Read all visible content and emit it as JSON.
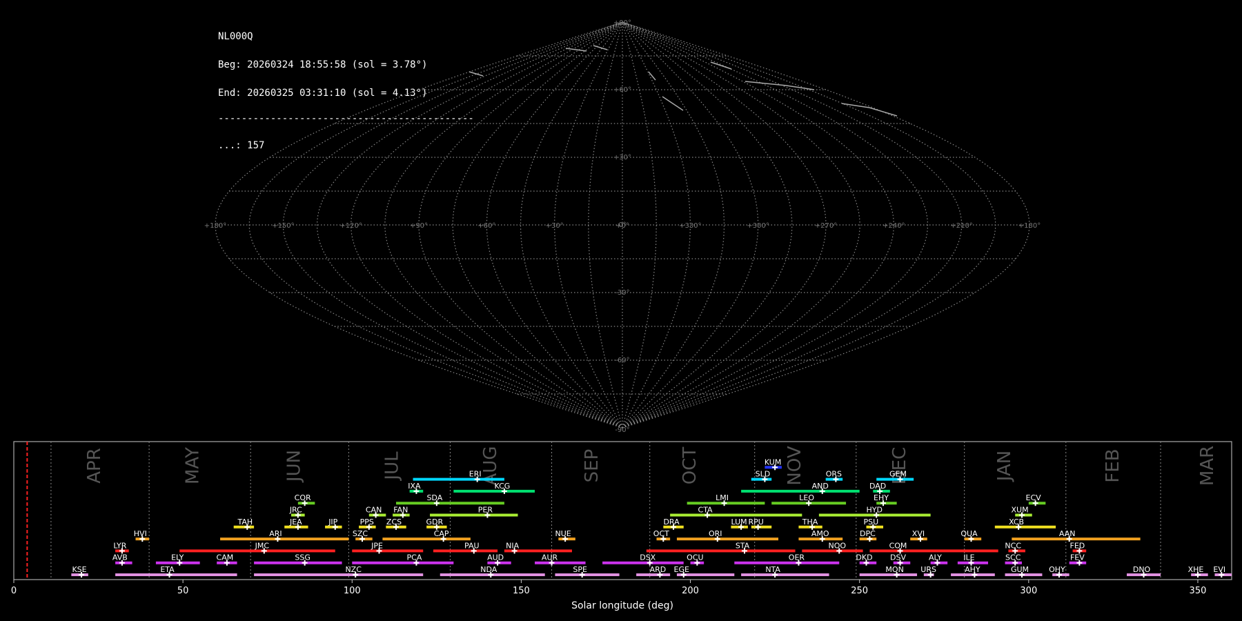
{
  "info": {
    "station": "NL000Q",
    "begin": "Beg: 20260324 18:55:58 (sol = 3.78°)",
    "end": "End: 20260325 03:31:10 (sol = 4.13°)",
    "separator": "--------------------------------------------",
    "count": "...: 157"
  },
  "sky": {
    "lat_labels": [
      "+90°",
      "+60°",
      "+30°",
      "0°",
      "-30°",
      "-60°",
      "-90°"
    ],
    "lon_labels": [
      "+180°",
      "+150°",
      "+120°",
      "+90°",
      "+60°",
      "+30°",
      "+0°",
      "+330°",
      "+300°",
      "+270°",
      "+240°",
      "+210°",
      "+180°"
    ]
  },
  "timeline": {
    "xlabel": "Solar longitude (deg)",
    "xticks": [
      "0",
      "50",
      "100",
      "150",
      "200",
      "250",
      "300",
      "350"
    ],
    "current_sol": 3.95,
    "months": [
      {
        "name": "APR",
        "x": 24
      },
      {
        "name": "MAY",
        "x": 53
      },
      {
        "name": "JUN",
        "x": 83
      },
      {
        "name": "JUL",
        "x": 112
      },
      {
        "name": "AUG",
        "x": 141
      },
      {
        "name": "SEP",
        "x": 171
      },
      {
        "name": "OCT",
        "x": 200
      },
      {
        "name": "NOV",
        "x": 231
      },
      {
        "name": "DEC",
        "x": 262
      },
      {
        "name": "JAN",
        "x": 293
      },
      {
        "name": "FEB",
        "x": 325
      },
      {
        "name": "MAR",
        "x": 353
      }
    ],
    "month_boundaries": [
      11,
      40,
      70,
      99,
      129,
      159,
      188,
      219,
      249,
      281,
      311,
      339
    ],
    "colors": {
      "white": "#ffffff",
      "blue": "#2233ff",
      "cyan": "#00d8ff",
      "green": "#00e070",
      "lime": "#66cc22",
      "yellowgreen": "#aaee33",
      "yellow": "#f0e020",
      "orange": "#f0a020",
      "red": "#ff2020",
      "magenta": "#cc33ee",
      "pink": "#e090e0"
    },
    "showers": [
      {
        "code": "KUM",
        "start": 222,
        "end": 227,
        "peak": 225,
        "row": 10,
        "color": "blue"
      },
      {
        "code": "ERI",
        "start": 118,
        "end": 145,
        "peak": 137,
        "row": 9,
        "color": "cyan"
      },
      {
        "code": "SLD",
        "start": 218,
        "end": 224,
        "peak": 222,
        "row": 9,
        "color": "cyan"
      },
      {
        "code": "ORS",
        "start": 240,
        "end": 245,
        "peak": 243,
        "row": 9,
        "color": "cyan"
      },
      {
        "code": "GEM",
        "start": 255,
        "end": 266,
        "peak": 262,
        "row": 9,
        "color": "cyan"
      },
      {
        "code": "IXA",
        "start": 117,
        "end": 121,
        "peak": 119,
        "row": 8,
        "color": "green"
      },
      {
        "code": "KCG",
        "start": 130,
        "end": 154,
        "peak": 145,
        "row": 8,
        "color": "green"
      },
      {
        "code": "AND",
        "start": 215,
        "end": 250,
        "peak": 239,
        "row": 8,
        "color": "green"
      },
      {
        "code": "DAD",
        "start": 254,
        "end": 259,
        "peak": 256,
        "row": 8,
        "color": "green"
      },
      {
        "code": "COR",
        "start": 84,
        "end": 89,
        "peak": 86,
        "row": 7,
        "color": "lime"
      },
      {
        "code": "SDA",
        "start": 113,
        "end": 145,
        "peak": 125,
        "row": 7,
        "color": "lime"
      },
      {
        "code": "LMI",
        "start": 199,
        "end": 222,
        "peak": 210,
        "row": 7,
        "color": "lime"
      },
      {
        "code": "LEO",
        "start": 224,
        "end": 246,
        "peak": 235,
        "row": 7,
        "color": "lime"
      },
      {
        "code": "EHY",
        "start": 255,
        "end": 261,
        "peak": 257,
        "row": 7,
        "color": "lime"
      },
      {
        "code": "ECV",
        "start": 300,
        "end": 305,
        "peak": 302,
        "row": 7,
        "color": "lime"
      },
      {
        "code": "JRC",
        "start": 82,
        "end": 86,
        "peak": 84,
        "row": 6,
        "color": "yellowgreen"
      },
      {
        "code": "CAN",
        "start": 105,
        "end": 110,
        "peak": 107,
        "row": 6,
        "color": "yellowgreen"
      },
      {
        "code": "FAN",
        "start": 112,
        "end": 117,
        "peak": 115,
        "row": 6,
        "color": "yellowgreen"
      },
      {
        "code": "PER",
        "start": 123,
        "end": 149,
        "peak": 140,
        "row": 6,
        "color": "yellowgreen"
      },
      {
        "code": "CTA",
        "start": 194,
        "end": 233,
        "peak": 205,
        "row": 6,
        "color": "yellowgreen"
      },
      {
        "code": "HYD",
        "start": 238,
        "end": 271,
        "peak": 255,
        "row": 6,
        "color": "yellowgreen"
      },
      {
        "code": "XUM",
        "start": 296,
        "end": 301,
        "peak": 298,
        "row": 6,
        "color": "yellowgreen"
      },
      {
        "code": "TAH",
        "start": 65,
        "end": 71,
        "peak": 69,
        "row": 5,
        "color": "yellow"
      },
      {
        "code": "JEA",
        "start": 80,
        "end": 87,
        "peak": 84,
        "row": 5,
        "color": "yellow"
      },
      {
        "code": "JIP",
        "start": 92,
        "end": 97,
        "peak": 95,
        "row": 5,
        "color": "yellow"
      },
      {
        "code": "PPS",
        "start": 102,
        "end": 107,
        "peak": 105,
        "row": 5,
        "color": "yellow"
      },
      {
        "code": "ZCS",
        "start": 110,
        "end": 116,
        "peak": 113,
        "row": 5,
        "color": "yellow"
      },
      {
        "code": "GDR",
        "start": 122,
        "end": 128,
        "peak": 125,
        "row": 5,
        "color": "yellow"
      },
      {
        "code": "DRA",
        "start": 192,
        "end": 198,
        "peak": 195,
        "row": 5,
        "color": "yellow"
      },
      {
        "code": "LUM",
        "start": 212,
        "end": 217,
        "peak": 215,
        "row": 5,
        "color": "yellow"
      },
      {
        "code": "RPU",
        "start": 218,
        "end": 224,
        "peak": 220,
        "row": 5,
        "color": "yellow"
      },
      {
        "code": "THA",
        "start": 232,
        "end": 239,
        "peak": 236,
        "row": 5,
        "color": "yellow"
      },
      {
        "code": "PSU",
        "start": 252,
        "end": 257,
        "peak": 254,
        "row": 5,
        "color": "yellow"
      },
      {
        "code": "XCB",
        "start": 290,
        "end": 308,
        "peak": 297,
        "row": 5,
        "color": "yellow"
      },
      {
        "code": "HVI",
        "start": 36,
        "end": 40,
        "peak": 38,
        "row": 4,
        "color": "orange"
      },
      {
        "code": "ARI",
        "start": 61,
        "end": 99,
        "peak": 78,
        "row": 4,
        "color": "orange"
      },
      {
        "code": "SZC",
        "start": 101,
        "end": 106,
        "peak": 103,
        "row": 4,
        "color": "orange"
      },
      {
        "code": "CAP",
        "start": 109,
        "end": 135,
        "peak": 127,
        "row": 4,
        "color": "orange"
      },
      {
        "code": "NUE",
        "start": 161,
        "end": 166,
        "peak": 163,
        "row": 4,
        "color": "orange"
      },
      {
        "code": "OCT",
        "start": 190,
        "end": 194,
        "peak": 192,
        "row": 4,
        "color": "orange"
      },
      {
        "code": "ORI",
        "start": 196,
        "end": 226,
        "peak": 208,
        "row": 4,
        "color": "orange"
      },
      {
        "code": "AMO",
        "start": 232,
        "end": 245,
        "peak": 239,
        "row": 4,
        "color": "orange"
      },
      {
        "code": "DPC",
        "start": 250,
        "end": 255,
        "peak": 253,
        "row": 4,
        "color": "orange"
      },
      {
        "code": "XVI",
        "start": 265,
        "end": 270,
        "peak": 268,
        "row": 4,
        "color": "orange"
      },
      {
        "code": "QUA",
        "start": 281,
        "end": 286,
        "peak": 283,
        "row": 4,
        "color": "orange"
      },
      {
        "code": "AAN",
        "start": 295,
        "end": 333,
        "peak": 312,
        "row": 4,
        "color": "orange"
      },
      {
        "code": "LYR",
        "start": 30,
        "end": 34,
        "peak": 32,
        "row": 3,
        "color": "red"
      },
      {
        "code": "JMC",
        "start": 49,
        "end": 95,
        "peak": 74,
        "row": 3,
        "color": "red"
      },
      {
        "code": "JPE",
        "start": 100,
        "end": 121,
        "peak": 108,
        "row": 3,
        "color": "red"
      },
      {
        "code": "PAU",
        "start": 124,
        "end": 143,
        "peak": 136,
        "row": 3,
        "color": "red"
      },
      {
        "code": "NIA",
        "start": 145,
        "end": 165,
        "peak": 148,
        "row": 3,
        "color": "red"
      },
      {
        "code": "STA",
        "start": 187,
        "end": 231,
        "peak": 216,
        "row": 3,
        "color": "red"
      },
      {
        "code": "NOO",
        "start": 233,
        "end": 251,
        "peak": 244,
        "row": 3,
        "color": "red"
      },
      {
        "code": "COM",
        "start": 253,
        "end": 291,
        "peak": 262,
        "row": 3,
        "color": "red"
      },
      {
        "code": "NCC",
        "start": 294,
        "end": 299,
        "peak": 296,
        "row": 3,
        "color": "red"
      },
      {
        "code": "FED",
        "start": 313,
        "end": 317,
        "peak": 315,
        "row": 3,
        "color": "red"
      },
      {
        "code": "AVB",
        "start": 30,
        "end": 35,
        "peak": 32,
        "row": 2,
        "color": "magenta"
      },
      {
        "code": "ELY",
        "start": 42,
        "end": 55,
        "peak": 49,
        "row": 2,
        "color": "magenta"
      },
      {
        "code": "CAM",
        "start": 60,
        "end": 66,
        "peak": 63,
        "row": 2,
        "color": "magenta"
      },
      {
        "code": "SSG",
        "start": 71,
        "end": 97,
        "peak": 86,
        "row": 2,
        "color": "magenta"
      },
      {
        "code": "PCA",
        "start": 100,
        "end": 130,
        "peak": 119,
        "row": 2,
        "color": "magenta"
      },
      {
        "code": "AUD",
        "start": 140,
        "end": 147,
        "peak": 143,
        "row": 2,
        "color": "magenta"
      },
      {
        "code": "AUR",
        "start": 154,
        "end": 169,
        "peak": 159,
        "row": 2,
        "color": "magenta"
      },
      {
        "code": "DSX",
        "start": 174,
        "end": 198,
        "peak": 188,
        "row": 2,
        "color": "magenta"
      },
      {
        "code": "OCU",
        "start": 200,
        "end": 204,
        "peak": 202,
        "row": 2,
        "color": "magenta"
      },
      {
        "code": "OER",
        "start": 213,
        "end": 244,
        "peak": 232,
        "row": 2,
        "color": "magenta"
      },
      {
        "code": "DKD",
        "start": 250,
        "end": 255,
        "peak": 252,
        "row": 2,
        "color": "magenta"
      },
      {
        "code": "DSV",
        "start": 260,
        "end": 265,
        "peak": 262,
        "row": 2,
        "color": "magenta"
      },
      {
        "code": "ALY",
        "start": 271,
        "end": 276,
        "peak": 273,
        "row": 2,
        "color": "magenta"
      },
      {
        "code": "ILE",
        "start": 279,
        "end": 288,
        "peak": 283,
        "row": 2,
        "color": "magenta"
      },
      {
        "code": "SCC",
        "start": 293,
        "end": 298,
        "peak": 296,
        "row": 2,
        "color": "magenta"
      },
      {
        "code": "FEV",
        "start": 312,
        "end": 317,
        "peak": 315,
        "row": 2,
        "color": "magenta"
      },
      {
        "code": "KSE",
        "start": 17,
        "end": 22,
        "peak": 20,
        "row": 1,
        "color": "pink"
      },
      {
        "code": "ETA",
        "start": 30,
        "end": 66,
        "peak": 46,
        "row": 1,
        "color": "pink"
      },
      {
        "code": "NZC",
        "start": 71,
        "end": 121,
        "peak": 101,
        "row": 1,
        "color": "pink"
      },
      {
        "code": "NDA",
        "start": 126,
        "end": 157,
        "peak": 141,
        "row": 1,
        "color": "pink"
      },
      {
        "code": "SPE",
        "start": 160,
        "end": 179,
        "peak": 168,
        "row": 1,
        "color": "pink"
      },
      {
        "code": "ARD",
        "start": 184,
        "end": 194,
        "peak": 191,
        "row": 1,
        "color": "pink"
      },
      {
        "code": "EGE",
        "start": 196,
        "end": 213,
        "peak": 198,
        "row": 1,
        "color": "pink"
      },
      {
        "code": "NTA",
        "start": 215,
        "end": 241,
        "peak": 225,
        "row": 1,
        "color": "pink"
      },
      {
        "code": "MON",
        "start": 250,
        "end": 267,
        "peak": 261,
        "row": 1,
        "color": "pink"
      },
      {
        "code": "URS",
        "start": 269,
        "end": 272,
        "peak": 271,
        "row": 1,
        "color": "pink"
      },
      {
        "code": "AHY",
        "start": 277,
        "end": 290,
        "peak": 284,
        "row": 1,
        "color": "pink"
      },
      {
        "code": "GUM",
        "start": 293,
        "end": 304,
        "peak": 298,
        "row": 1,
        "color": "pink"
      },
      {
        "code": "OHY",
        "start": 307,
        "end": 312,
        "peak": 309,
        "row": 1,
        "color": "pink"
      },
      {
        "code": "DNO",
        "start": 329,
        "end": 339,
        "peak": 334,
        "row": 1,
        "color": "pink"
      },
      {
        "code": "XHE",
        "start": 348,
        "end": 353,
        "peak": 350,
        "row": 1,
        "color": "pink"
      },
      {
        "code": "EVI",
        "start": 355,
        "end": 360,
        "peak": 357,
        "row": 1,
        "color": "pink"
      }
    ]
  }
}
